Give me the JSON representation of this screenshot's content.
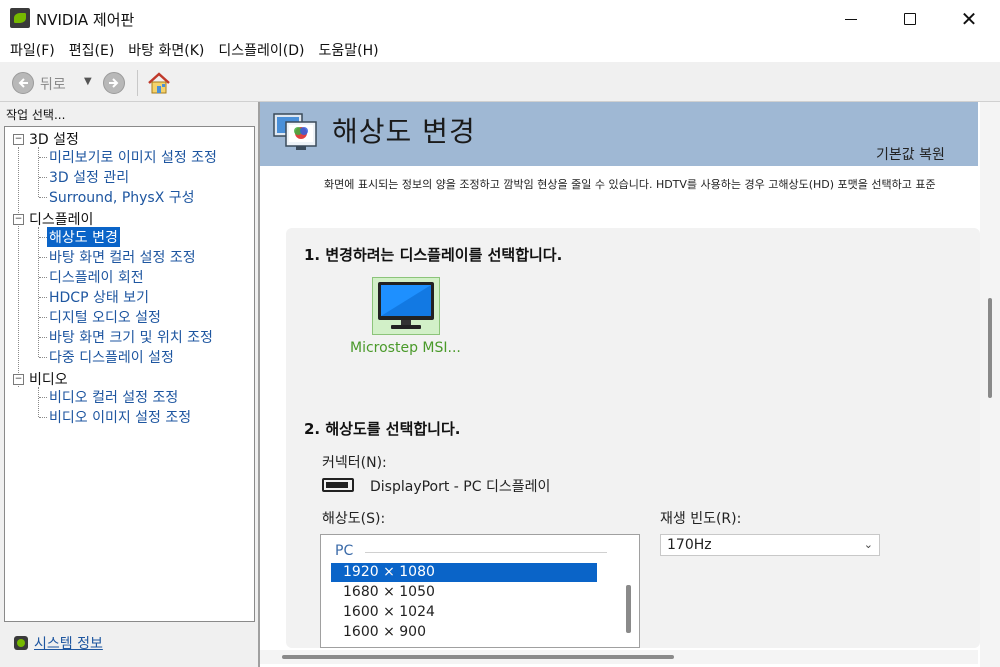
{
  "window": {
    "title": "NVIDIA 제어판",
    "minimize_label": "",
    "maximize_label": "",
    "close_label": "✕"
  },
  "menu": {
    "items": [
      "파일(F)",
      "편집(E)",
      "바탕 화면(K)",
      "디스플레이(D)",
      "도움말(H)"
    ]
  },
  "toolbar": {
    "back_label": "뒤로",
    "back_icon": "arrow-left-icon",
    "forward_icon": "arrow-right-icon",
    "home_icon": "home-icon"
  },
  "sidebar": {
    "task_label": "작업 선택...",
    "categories": [
      {
        "label": "3D 설정",
        "expanded": true,
        "items": [
          "미리보기로 이미지 설정 조정",
          "3D 설정 관리",
          "Surround, PhysX 구성"
        ]
      },
      {
        "label": "디스플레이",
        "expanded": true,
        "items": [
          "해상도 변경",
          "바탕 화면 컬러 설정 조정",
          "디스플레이 회전",
          "HDCP 상태 보기",
          "디지털 오디오 설정",
          "바탕 화면 크기 및 위치 조정",
          "다중 디스플레이 설정"
        ]
      },
      {
        "label": "비디오",
        "expanded": true,
        "items": [
          "비디오 컬러 설정 조정",
          "비디오 이미지 설정 조정"
        ]
      }
    ],
    "selected_item": "해상도 변경",
    "system_info": "시스템 정보"
  },
  "main": {
    "title": "해상도 변경",
    "restore_defaults": "기본값 복원",
    "description": "화면에 표시되는 정보의 양을 조정하고 깜박임 현상을 줄일 수 있습니다. HDTV를 사용하는 경우 고해상도(HD) 포맷을 선택하고 표준",
    "step1_title": "1. 변경하려는 디스플레이를 선택합니다.",
    "display_name": "Microstep MSI...",
    "step2_title": "2. 해상도를 선택합니다.",
    "connector_label": "커넥터(N):",
    "connector_value": "DisplayPort - PC 디스플레이",
    "resolution_label": "해상도(S):",
    "resolution_group": "PC",
    "resolutions": [
      "1920 × 1080",
      "1680 × 1050",
      "1600 × 1024",
      "1600 × 900"
    ],
    "selected_resolution": "1920 × 1080",
    "refresh_label": "재생 빈도(R):",
    "refresh_value": "170Hz"
  },
  "colors": {
    "accent_selection": "#0a64c8",
    "link": "#1e56a0",
    "header_band": "#9fb8d4",
    "nvidia_green": "#76b900",
    "display_name_green": "#4a9a2a"
  }
}
